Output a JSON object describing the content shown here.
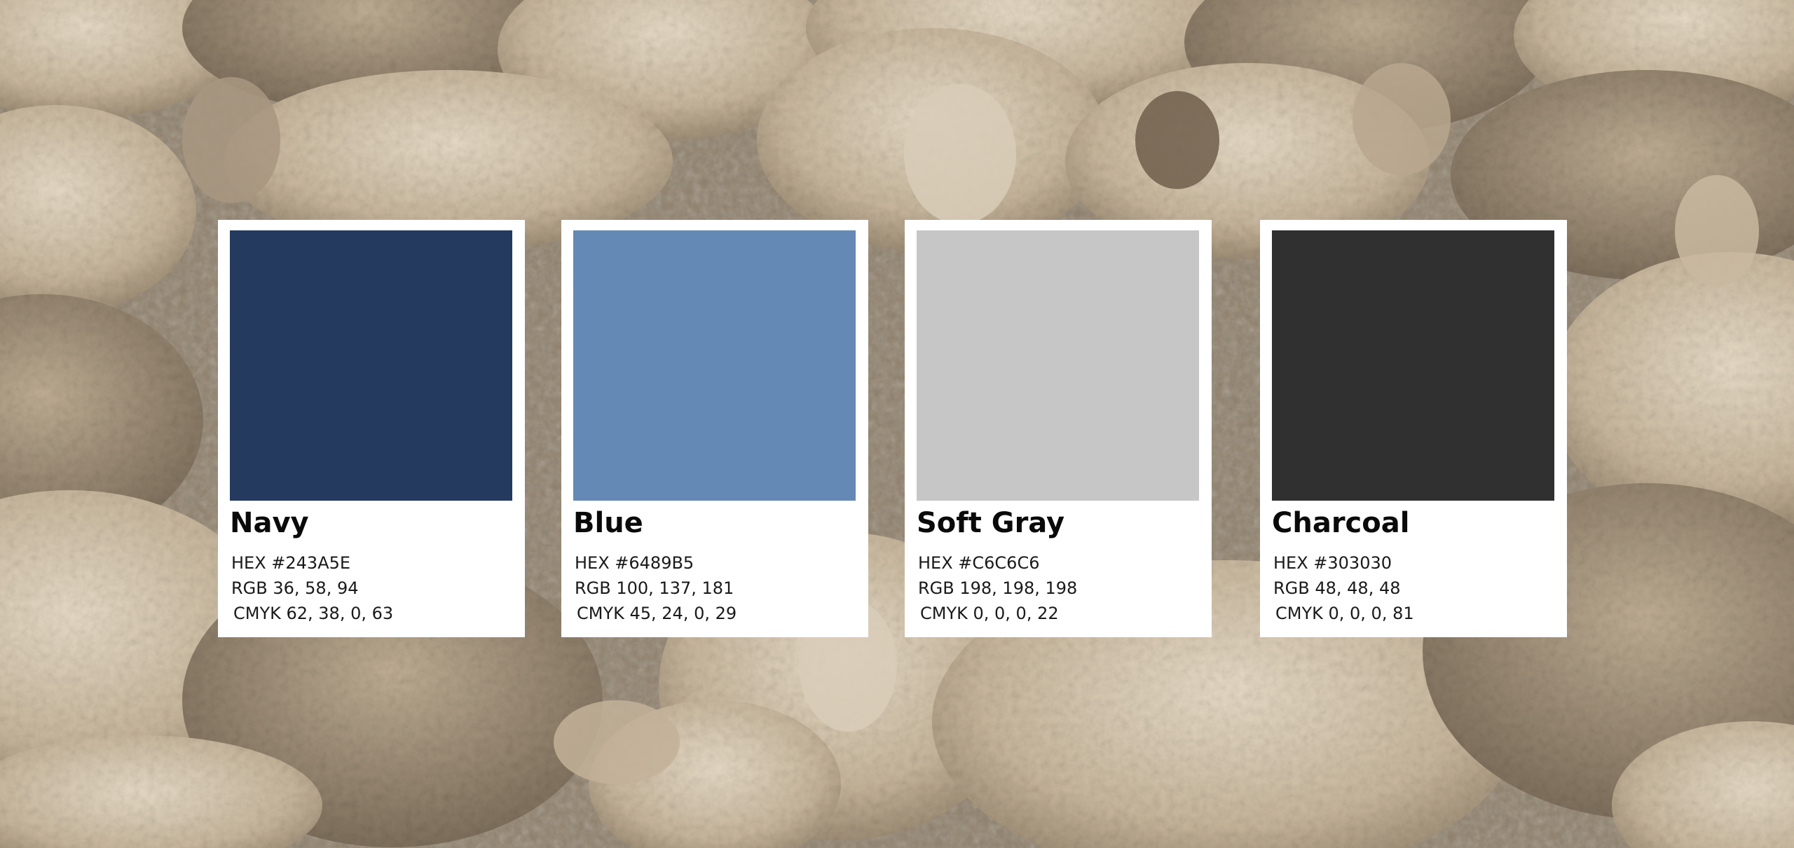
{
  "palette": {
    "colors": [
      {
        "name": "Navy",
        "swatch": "#243A5E",
        "hex": "HEX #243A5E",
        "rgb": "RGB 36, 58, 94",
        "cmyk": "CMYK 62, 38, 0, 63"
      },
      {
        "name": "Blue",
        "swatch": "#6489B5",
        "hex": "HEX #6489B5",
        "rgb": "RGB 100, 137, 181",
        "cmyk": "CMYK 45, 24, 0, 29"
      },
      {
        "name": "Soft Gray",
        "swatch": "#C6C6C6",
        "hex": "HEX #C6C6C6",
        "rgb": "RGB 198, 198, 198",
        "cmyk": "CMYK 0, 0, 0, 22"
      },
      {
        "name": "Charcoal",
        "swatch": "#303030",
        "hex": "HEX #303030",
        "rgb": "RGB 48, 48, 48",
        "cmyk": "CMYK 0, 0, 0, 81"
      }
    ]
  },
  "background": {
    "subject": "flock-of-sheep-photo",
    "tones": [
      "#cbbba2",
      "#b5a48b",
      "#9c8c75",
      "#7a6b58",
      "#e2d6c2"
    ]
  }
}
